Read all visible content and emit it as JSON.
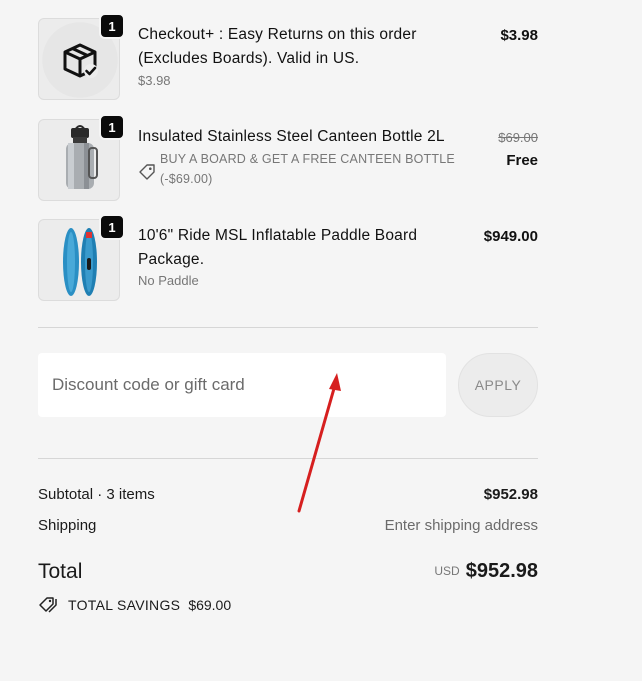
{
  "items": [
    {
      "quantity": "1",
      "title_line1": "Checkout+ : Easy Returns on this order",
      "title_line2": "(Excludes Boards). Valid in US.",
      "subtitle": "$3.98",
      "price": "$3.98",
      "icon": "box-check-icon"
    },
    {
      "quantity": "1",
      "title_line1": "Insulated Stainless Steel Canteen Bottle 2L",
      "promo_line1": "BUY A BOARD & GET A FREE CANTEEN BOTTLE",
      "promo_line2": "(-$69.00)",
      "original_price": "$69.00",
      "price": "Free",
      "icon": "canteen-bottle-image"
    },
    {
      "quantity": "1",
      "title_line1": "10'6\" Ride MSL Inflatable Paddle Board",
      "title_line2": "Package.",
      "subtitle": "No Paddle",
      "price": "$949.00",
      "icon": "paddle-board-image"
    }
  ],
  "discount": {
    "placeholder": "Discount code or gift card",
    "apply_label": "APPLY"
  },
  "summary": {
    "subtotal_label": "Subtotal · 3 items",
    "subtotal_value": "$952.98",
    "shipping_label": "Shipping",
    "shipping_value": "Enter shipping address",
    "total_label": "Total",
    "currency": "USD",
    "total_value": "$952.98",
    "savings_label": "TOTAL SAVINGS",
    "savings_value": "$69.00"
  },
  "colors": {
    "background": "#f5f5f5",
    "badge": "#0a0a0a",
    "annotation_arrow": "#d61f1f"
  }
}
